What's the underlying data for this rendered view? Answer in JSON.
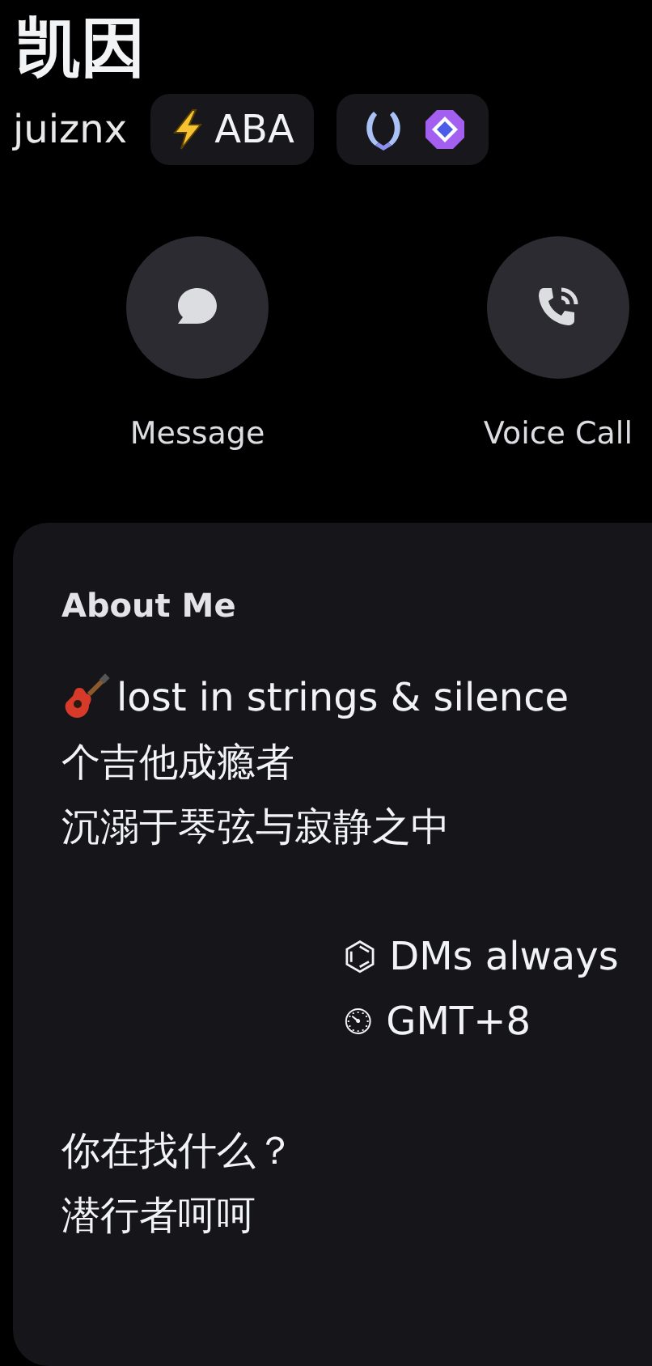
{
  "profile": {
    "display_name": "凯因",
    "username": "juiznx",
    "tag": "ABA"
  },
  "actions": [
    {
      "kind": "message",
      "label": "Message"
    },
    {
      "kind": "call",
      "label": "Voice Call"
    }
  ],
  "about": {
    "title": "About Me",
    "paragraphs": [
      {
        "indented": false,
        "lines": [
          {
            "kind": "emoji",
            "text": "lost in strings & silence"
          },
          {
            "kind": "text",
            "text": "个吉他成瘾者"
          },
          {
            "kind": "text",
            "text": "沉溺于琴弦与寂静之中"
          }
        ]
      },
      {
        "indented": true,
        "lines": [
          {
            "kind": "text",
            "text": "⌬ DMs always"
          },
          {
            "kind": "text",
            "text": "⏲ GMT+8"
          }
        ]
      },
      {
        "indented": false,
        "lines": [
          {
            "kind": "text",
            "text": "你在找什么？"
          },
          {
            "kind": "text",
            "text": "潜行者呵呵"
          }
        ]
      }
    ]
  }
}
